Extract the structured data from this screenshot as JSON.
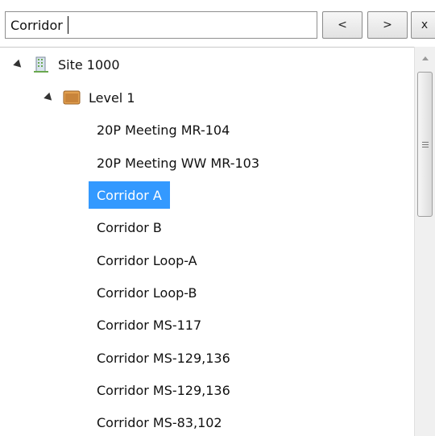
{
  "search": {
    "value": "Corridor",
    "prev_label": "<",
    "next_label": ">",
    "close_label": "x"
  },
  "tree": {
    "site": {
      "label": "Site 1000",
      "icon": "building-icon"
    },
    "level": {
      "label": "Level 1",
      "icon": "folder-icon"
    },
    "items": [
      {
        "label": "20P Meeting MR-104",
        "selected": false
      },
      {
        "label": "20P Meeting WW MR-103",
        "selected": false
      },
      {
        "label": "Corridor A",
        "selected": true
      },
      {
        "label": "Corridor B",
        "selected": false
      },
      {
        "label": "Corridor Loop-A",
        "selected": false
      },
      {
        "label": "Corridor Loop-B",
        "selected": false
      },
      {
        "label": "Corridor MS-117",
        "selected": false
      },
      {
        "label": "Corridor MS-129,136",
        "selected": false
      },
      {
        "label": "Corridor MS-129,136",
        "selected": false
      },
      {
        "label": "Corridor MS-83,102",
        "selected": false
      }
    ]
  },
  "colors": {
    "selection": "#3399ff",
    "folder": "#c8843a",
    "building": "#6aa84f"
  }
}
